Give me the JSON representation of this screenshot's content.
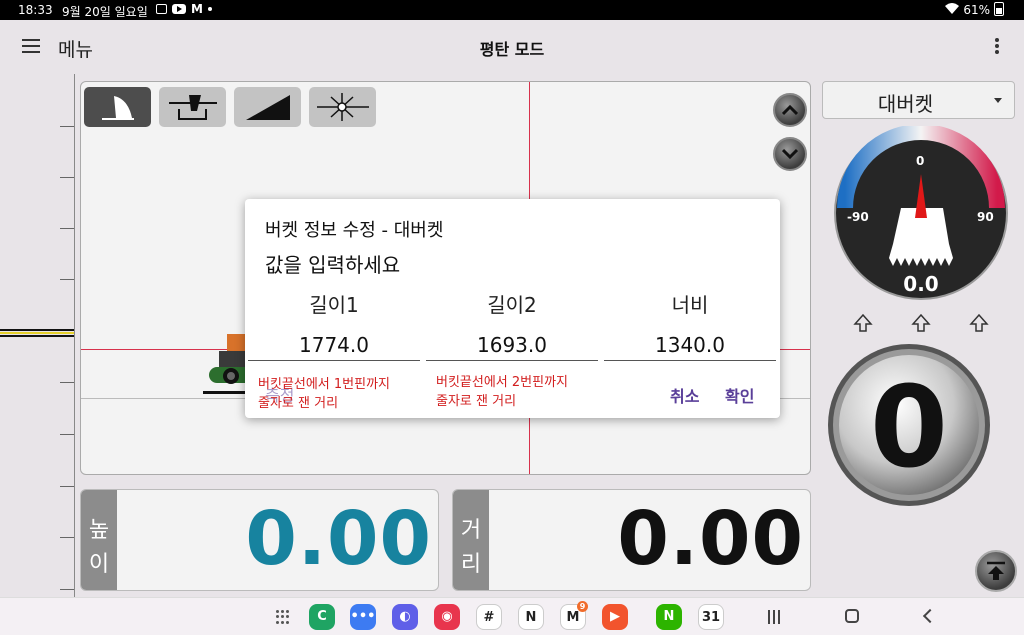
{
  "status_bar": {
    "time": "18:33",
    "date": "9월 20일 일요일",
    "gmail_glyph": "M",
    "battery": "61%"
  },
  "app_bar": {
    "menu_label": "메뉴",
    "title": "평탄 모드"
  },
  "dialog": {
    "title": "버켓 정보 수정 - 대버켓",
    "subtitle": "값을 입력하세요",
    "fields": [
      {
        "label": "길이1",
        "value": "1774.0",
        "hint": "버킷끝선에서 1번핀까지\n줄자로 잰 거리"
      },
      {
        "label": "길이2",
        "value": "1693.0",
        "hint": "버킷끝선에서 2번핀까지\n줄자로 잰 거리"
      },
      {
        "label": "너비",
        "value": "1340.0"
      }
    ],
    "ghost_button": "측정",
    "cancel": "취소",
    "confirm": "확인"
  },
  "readouts": {
    "height": {
      "label_1": "높",
      "label_2": "이",
      "value": "0.00",
      "color": "#17839f"
    },
    "distance": {
      "label_1": "거",
      "label_2": "리",
      "value": "0.00",
      "color": "#111111"
    }
  },
  "bucket_select": {
    "selected": "대버켓"
  },
  "gauge": {
    "center_label": "0",
    "min_label": "-90",
    "max_label": "90",
    "reading": "0.0"
  },
  "big_dial": {
    "value": "0"
  },
  "taskbar": {
    "apps": [
      {
        "name": "phone-app-icon",
        "glyph": "C",
        "color": "#1fa463"
      },
      {
        "name": "messages-app-icon",
        "glyph": "•••",
        "color": "#3d7bf2"
      },
      {
        "name": "internet-app-icon",
        "glyph": "◐",
        "color": "#5f5fe8"
      },
      {
        "name": "camera-app-icon",
        "glyph": "◉",
        "color": "#e8354d"
      },
      {
        "name": "slack-app-icon",
        "glyph": "#",
        "color": "#ffffff"
      },
      {
        "name": "notion-app-icon",
        "glyph": "N",
        "color": "#ffffff"
      },
      {
        "name": "gmail-app-icon",
        "glyph": "M",
        "color": "#ffffff",
        "badge": "9"
      },
      {
        "name": "screen-recorder-app-icon",
        "glyph": "▶",
        "color": "#f2542d"
      },
      {
        "name": "naver-app-icon",
        "glyph": "N",
        "color": "#2db400"
      },
      {
        "name": "calendar-app-icon",
        "glyph": "31",
        "color": "#ffffff"
      }
    ]
  },
  "colors": {
    "crosshair": "#d7314c",
    "dialog_button": "#5a3f99",
    "hint_text": "#d21e1e"
  }
}
